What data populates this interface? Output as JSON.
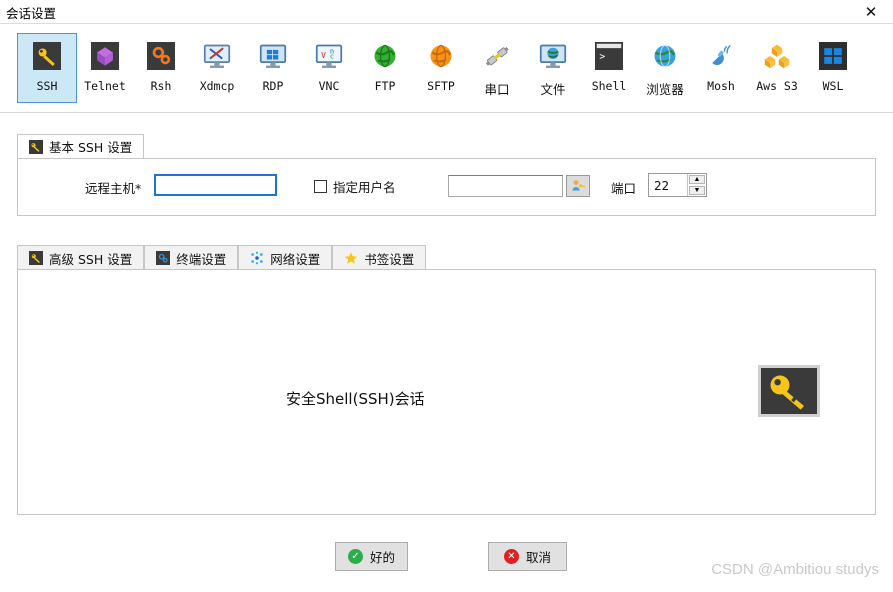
{
  "window": {
    "title": "会话设置",
    "close_label": "✕"
  },
  "protocols": [
    {
      "id": "ssh",
      "label": "SSH",
      "icon": "key-icon",
      "selected": true
    },
    {
      "id": "telnet",
      "label": "Telnet",
      "icon": "cube-icon",
      "selected": false
    },
    {
      "id": "rsh",
      "label": "Rsh",
      "icon": "gears-icon",
      "selected": false
    },
    {
      "id": "xdmcp",
      "label": "Xdmcp",
      "icon": "monitor-x-icon",
      "selected": false
    },
    {
      "id": "rdp",
      "label": "RDP",
      "icon": "monitor-win-icon",
      "selected": false
    },
    {
      "id": "vnc",
      "label": "VNC",
      "icon": "monitor-vnc-icon",
      "selected": false
    },
    {
      "id": "ftp",
      "label": "FTP",
      "icon": "globe-green-icon",
      "selected": false
    },
    {
      "id": "sftp",
      "label": "SFTP",
      "icon": "globe-orange-icon",
      "selected": false
    },
    {
      "id": "serial",
      "label": "串口",
      "icon": "plug-icon",
      "selected": false
    },
    {
      "id": "file",
      "label": "文件",
      "icon": "globe-monitor-icon",
      "selected": false
    },
    {
      "id": "shell",
      "label": "Shell",
      "icon": "terminal-icon",
      "selected": false
    },
    {
      "id": "browser",
      "label": "浏览器",
      "icon": "globe-blue-icon",
      "selected": false
    },
    {
      "id": "mosh",
      "label": "Mosh",
      "icon": "satellite-icon",
      "selected": false
    },
    {
      "id": "awss3",
      "label": "Aws S3",
      "icon": "aws-cubes-icon",
      "selected": false
    },
    {
      "id": "wsl",
      "label": "WSL",
      "icon": "windows-icon",
      "selected": false
    }
  ],
  "basic_panel": {
    "tab": {
      "label": "基本 SSH 设置",
      "icon": "key-icon",
      "active": true
    },
    "remote_host": {
      "label": "远程主机*",
      "value": "",
      "placeholder": ""
    },
    "specify_username": {
      "label": "指定用户名",
      "checked": false
    },
    "username": {
      "value": "",
      "placeholder": ""
    },
    "user_browse_button": {
      "icon": "user-key-icon"
    },
    "port": {
      "label": "端口",
      "value": "22",
      "up_label": "▲",
      "down_label": "▼"
    }
  },
  "advanced_tabs": [
    {
      "id": "advanced-ssh",
      "label": "高级 SSH 设置",
      "icon": "key-icon",
      "active": false
    },
    {
      "id": "terminal",
      "label": "终端设置",
      "icon": "gears-blue-icon",
      "active": false
    },
    {
      "id": "network",
      "label": "网络设置",
      "icon": "network-dots-icon",
      "active": false
    },
    {
      "id": "bookmark",
      "label": "书签设置",
      "icon": "star-icon",
      "active": false
    }
  ],
  "content": {
    "description": "安全Shell(SSH)会话",
    "icon": "big-key-icon"
  },
  "footer": {
    "ok": {
      "label": "好的",
      "badge": "✓"
    },
    "cancel": {
      "label": "取消",
      "badge": "✕"
    }
  },
  "watermark": "CSDN @Ambitiou  studys",
  "colors": {
    "selected_tile_bg": "#cce8f7",
    "selected_tile_border": "#4b97d2",
    "focus_border": "#1976d2",
    "ok_badge": "#2bae4a",
    "cancel_badge": "#e02020",
    "key_yellow": "#f5c518"
  }
}
